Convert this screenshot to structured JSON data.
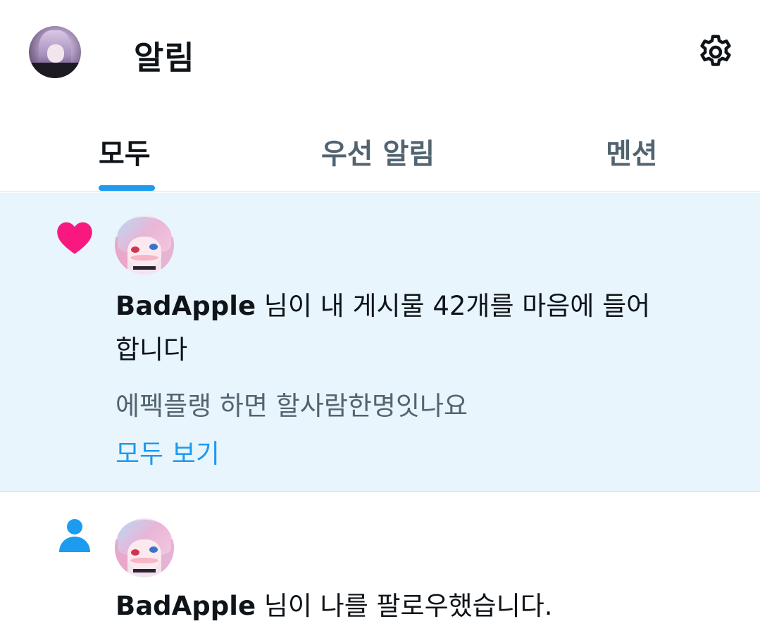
{
  "header": {
    "title": "알림"
  },
  "tabs": [
    {
      "label": "모두",
      "active": true
    },
    {
      "label": "우선 알림",
      "active": false
    },
    {
      "label": "멘션",
      "active": false
    }
  ],
  "notifications": [
    {
      "icon": "heart-icon",
      "icon_color": "#f91880",
      "user": "BadApple",
      "message_line1": " 님이 내 게시물 42개를 마음에 들어",
      "message_line2": "합니다",
      "preview": "에펙플랭 하면 할사람한명잇나요",
      "more_label": "모두 보기",
      "unread": true
    },
    {
      "icon": "person-icon",
      "icon_color": "#1d9bf0",
      "user": "BadApple",
      "message_line1": " 님이 나를 팔로우했습니다.",
      "unread": false
    }
  ],
  "colors": {
    "accent": "#1d9bf0",
    "unread_bg": "#e8f5fd",
    "like": "#f91880",
    "secondary_text": "#536471"
  }
}
